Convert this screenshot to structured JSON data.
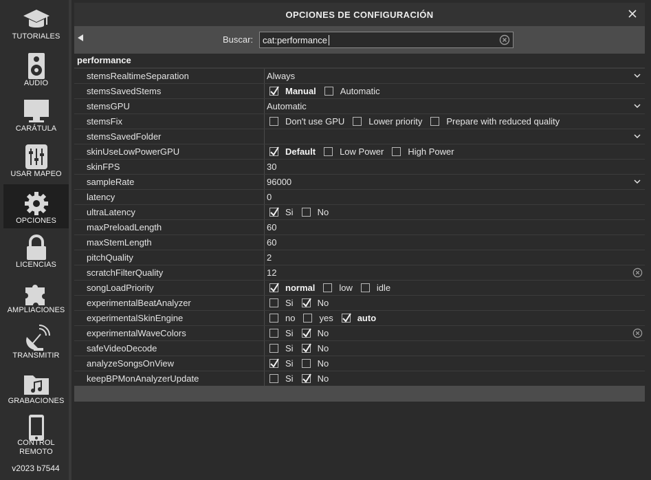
{
  "sidebar": {
    "items": [
      {
        "label": "TUTORIALES",
        "icon": "graduation-cap-icon"
      },
      {
        "label": "AUDIO",
        "icon": "speaker-icon"
      },
      {
        "label": "CARÁTULA",
        "icon": "monitor-icon"
      },
      {
        "label": "USAR MAPEO",
        "icon": "mixer-sliders-icon"
      },
      {
        "label": "OPCIONES",
        "icon": "gear-icon",
        "active": true
      },
      {
        "label": "LICENCIAS",
        "icon": "lock-icon"
      },
      {
        "label": "AMPLIACIONES",
        "icon": "puzzle-icon"
      },
      {
        "label": "TRANSMITIR",
        "icon": "satellite-dish-icon"
      },
      {
        "label": "GRABACIONES",
        "icon": "music-folder-icon"
      },
      {
        "label_line1": "CONTROL",
        "label_line2": "REMOTO",
        "icon": "phone-icon"
      }
    ],
    "version": "v2023 b7544"
  },
  "dialog": {
    "title": "OPCIONES DE CONFIGURACIÓN",
    "search_label": "Buscar:",
    "search_value": "cat:performance"
  },
  "section": "performance",
  "rows": [
    {
      "name": "stemsRealtimeSeparation",
      "type": "dropdown",
      "value": "Always"
    },
    {
      "name": "stemsSavedStems",
      "type": "options",
      "options": [
        {
          "label": "Manual",
          "checked": true,
          "selected": true
        },
        {
          "label": "Automatic",
          "checked": false
        }
      ]
    },
    {
      "name": "stemsGPU",
      "type": "dropdown",
      "value": "Automatic"
    },
    {
      "name": "stemsFix",
      "type": "options",
      "options": [
        {
          "label": "Don't use GPU",
          "checked": false
        },
        {
          "label": "Lower priority",
          "checked": false
        },
        {
          "label": "Prepare with reduced quality",
          "checked": false
        }
      ]
    },
    {
      "name": "stemsSavedFolder",
      "type": "dropdown",
      "value": ""
    },
    {
      "name": "skinUseLowPowerGPU",
      "type": "options",
      "options": [
        {
          "label": "Default",
          "checked": true,
          "selected": true
        },
        {
          "label": "Low Power",
          "checked": false
        },
        {
          "label": "High Power",
          "checked": false
        }
      ]
    },
    {
      "name": "skinFPS",
      "type": "text",
      "value": "30"
    },
    {
      "name": "sampleRate",
      "type": "dropdown",
      "value": "96000"
    },
    {
      "name": "latency",
      "type": "text",
      "value": "0"
    },
    {
      "name": "ultraLatency",
      "type": "options",
      "options": [
        {
          "label": "Si",
          "checked": true
        },
        {
          "label": "No",
          "checked": false
        }
      ]
    },
    {
      "name": "maxPreloadLength",
      "type": "text",
      "value": "60"
    },
    {
      "name": "maxStemLength",
      "type": "text",
      "value": "60"
    },
    {
      "name": "pitchQuality",
      "type": "text",
      "value": "2"
    },
    {
      "name": "scratchFilterQuality",
      "type": "text",
      "value": "12",
      "clear": true
    },
    {
      "name": "songLoadPriority",
      "type": "options",
      "options": [
        {
          "label": "normal",
          "checked": true,
          "selected": true
        },
        {
          "label": "low",
          "checked": false
        },
        {
          "label": "idle",
          "checked": false
        }
      ]
    },
    {
      "name": "experimentalBeatAnalyzer",
      "type": "options",
      "options": [
        {
          "label": "Si",
          "checked": false
        },
        {
          "label": "No",
          "checked": true
        }
      ]
    },
    {
      "name": "experimentalSkinEngine",
      "type": "options",
      "options": [
        {
          "label": "no",
          "checked": false
        },
        {
          "label": "yes",
          "checked": false
        },
        {
          "label": "auto",
          "checked": true,
          "selected": true
        }
      ]
    },
    {
      "name": "experimentalWaveColors",
      "type": "options",
      "options": [
        {
          "label": "Si",
          "checked": false
        },
        {
          "label": "No",
          "checked": true
        }
      ],
      "clear": true
    },
    {
      "name": "safeVideoDecode",
      "type": "options",
      "options": [
        {
          "label": "Si",
          "checked": false
        },
        {
          "label": "No",
          "checked": true
        }
      ]
    },
    {
      "name": "analyzeSongsOnView",
      "type": "options",
      "options": [
        {
          "label": "Si",
          "checked": true
        },
        {
          "label": "No",
          "checked": false
        }
      ]
    },
    {
      "name": "keepBPMonAnalyzerUpdate",
      "type": "options",
      "options": [
        {
          "label": "Si",
          "checked": false
        },
        {
          "label": "No",
          "checked": true
        }
      ]
    }
  ],
  "colors": {
    "background": "#2b2b2b",
    "header": "#333333",
    "dialog_body": "#4c4c4c"
  }
}
